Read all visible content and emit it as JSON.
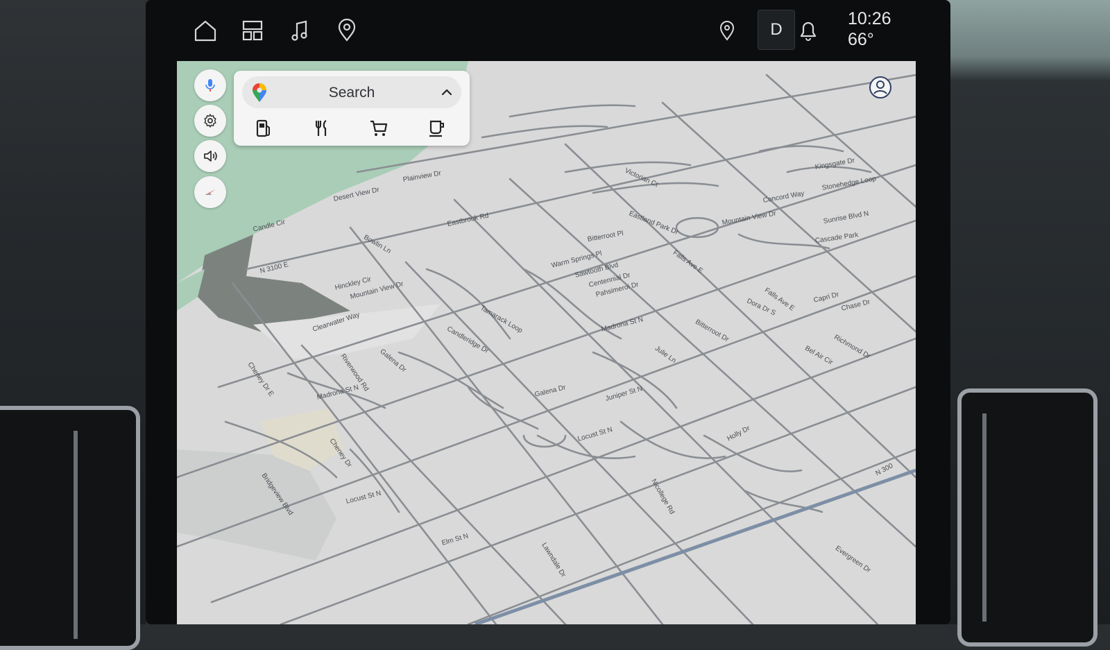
{
  "status_bar": {
    "icons": [
      "home-icon",
      "apps-grid-icon",
      "music-note-icon",
      "navigation-pin-icon"
    ],
    "right_icons": [
      "location-pin-icon",
      "notification-bell-icon"
    ],
    "driver_profile": "D",
    "time": "10:26",
    "temperature": "66°"
  },
  "map_controls": [
    "microphone-icon",
    "settings-gear-icon",
    "volume-icon",
    "compass-icon"
  ],
  "search": {
    "label": "Search",
    "categories": [
      "gas-station-icon",
      "restaurant-icon",
      "shopping-cart-icon",
      "coffee-icon"
    ]
  },
  "colors": {
    "map_background": "#d9d9d9",
    "road": "#8a8e93",
    "highway": "#7d8fa6",
    "park": "#a9cdb7",
    "water_dark": "#7c837f"
  },
  "streets": [
    "Candle Cir",
    "N 3100 E",
    "Hinckley Cir",
    "Mountain View Dr",
    "Clearwater Way",
    "Riverwood Rd",
    "Galena Dr",
    "Candleridge Dr",
    "Tamarack Loop",
    "Warm Springs Pl",
    "Sawtooth Blvd",
    "Centennial Dr",
    "Pahsimeroi Dr",
    "Madrona St N",
    "Julie Ln",
    "Juniper St N",
    "Galena Dr",
    "Locust St N",
    "Cheney Dr",
    "Elm St N",
    "Lawndale Dr",
    "Nicollege Rd",
    "Holly Dr",
    "N 300",
    "Evergreen Dr",
    "Falls Ave E",
    "Capri Dr",
    "Chase Dr",
    "Richmond Dr",
    "Bel Air Cir",
    "Bitterroot Dr",
    "Dora Dr S",
    "Eastland Park Dr",
    "Cascade Park",
    "Falls Ave E",
    "Madrona St N",
    "Cheney Dr E",
    "Bridgeview Blvd",
    "Locust St N",
    "Desert View Dr",
    "Plainview Dr",
    "Bowlin Ln",
    "Eastbrook Rd",
    "Bitterroot Pl",
    "Victorian Ct",
    "Stonehedge Loop",
    "Concord Way",
    "Mountain View Dr",
    "Sunrise Blvd N",
    "Kingsgate Dr"
  ]
}
